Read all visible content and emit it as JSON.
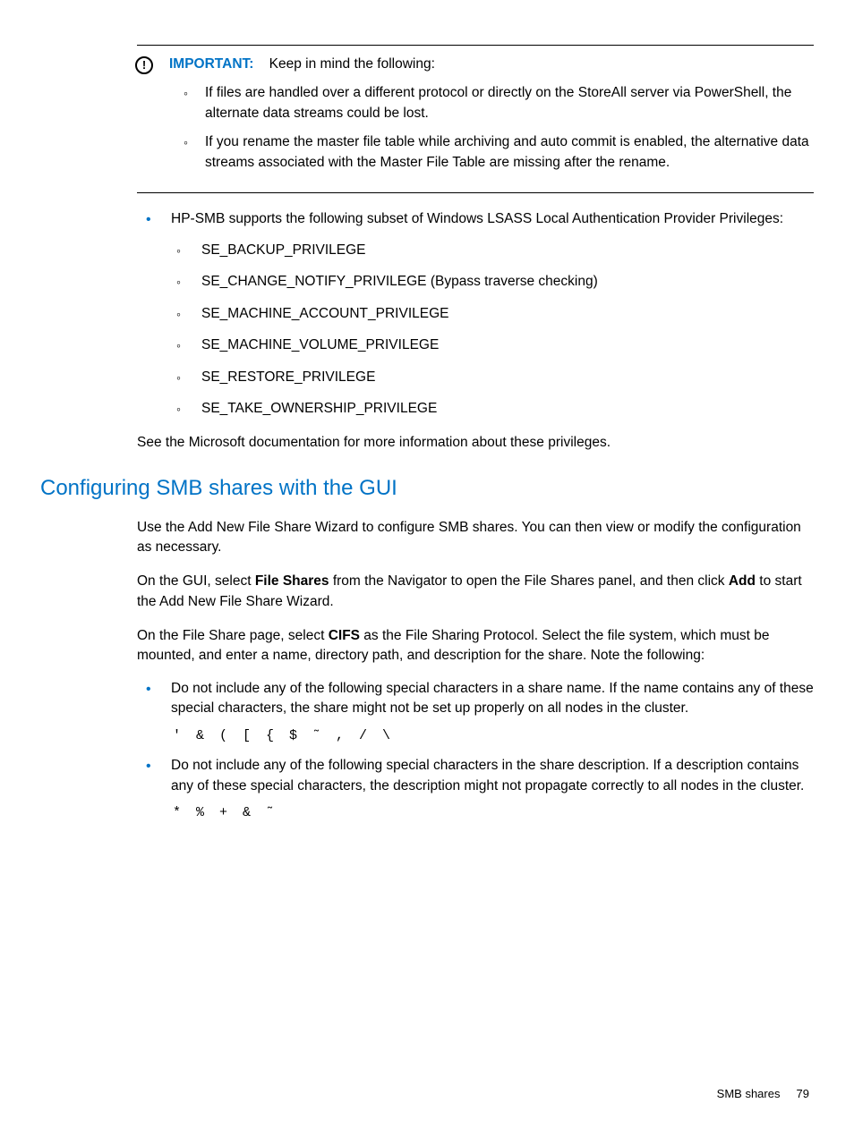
{
  "callout": {
    "label": "IMPORTANT:",
    "intro": "Keep in mind the following:",
    "items": [
      "If files are handled over a different protocol or directly on the StoreAll server via PowerShell, the alternate data streams could be lost.",
      "If you rename the master file table while archiving and auto commit is enabled, the alternative data streams associated with the Master File Table are missing after the rename."
    ]
  },
  "privileges": {
    "intro": "HP-SMB supports the following subset of Windows LSASS Local Authentication Provider Privileges:",
    "items": [
      "SE_BACKUP_PRIVILEGE",
      "SE_CHANGE_NOTIFY_PRIVILEGE (Bypass traverse checking)",
      "SE_MACHINE_ACCOUNT_PRIVILEGE",
      "SE_MACHINE_VOLUME_PRIVILEGE",
      "SE_RESTORE_PRIVILEGE",
      "SE_TAKE_OWNERSHIP_PRIVILEGE"
    ],
    "outro": "See the Microsoft documentation for more information about these privileges."
  },
  "section": {
    "heading": "Configuring SMB shares with the GUI",
    "p1": "Use the Add New File Share Wizard to configure SMB shares. You can then view or modify the configuration as necessary.",
    "p2a": "On the GUI, select ",
    "p2b": "File Shares",
    "p2c": " from the Navigator to open the File Shares panel, and then click ",
    "p2d": "Add",
    "p2e": " to start the Add New File Share Wizard.",
    "p3a": "On the File Share page, select ",
    "p3b": "CIFS",
    "p3c": " as the File Sharing Protocol. Select the file system, which must be mounted, and enter a name, directory path, and description for the share. Note the following:",
    "notes": [
      {
        "text": "Do not include any of the following special characters in a share name. If the name contains any of these special characters, the share might not be set up properly on all nodes in the cluster.",
        "chars": "' & ( [ { $ ˜ , / \\"
      },
      {
        "text": "Do not include any of the following special characters in the share description. If a description contains any of these special characters, the description might not propagate correctly to all nodes in the cluster.",
        "chars": "* % + & ˜"
      }
    ]
  },
  "footer": {
    "label": "SMB shares",
    "page": "79"
  }
}
